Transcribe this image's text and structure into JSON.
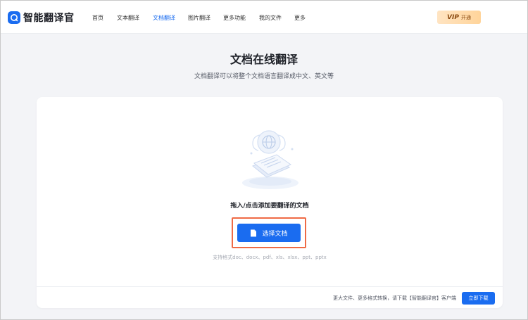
{
  "app": {
    "name": "智能翻译官"
  },
  "nav": {
    "items": [
      {
        "label": "首页",
        "active": false
      },
      {
        "label": "文本翻译",
        "active": false
      },
      {
        "label": "文档翻译",
        "active": true
      },
      {
        "label": "图片翻译",
        "active": false
      },
      {
        "label": "更多功能",
        "active": false
      },
      {
        "label": "我的文件",
        "active": false
      },
      {
        "label": "更多",
        "active": false
      }
    ]
  },
  "vip": {
    "badge": "VIP",
    "label": "开通"
  },
  "main": {
    "title": "文档在线翻译",
    "subtitle": "文档翻译可以将整个文档语言翻译成中文、英文等"
  },
  "upload": {
    "drop_text": "拖入/点击添加要翻译的文档",
    "button_label": "选择文档",
    "formats": "支持格式doc、docx、pdf、xls、xlsx、ppt、pptx"
  },
  "footer": {
    "promo_text": "更大文件、更多格式转换，请下载【智能翻译官】客户端",
    "download_label": "立即下载"
  },
  "colors": {
    "accent": "#1a6cf0",
    "highlight": "#ef6a45",
    "vip_bg": "#ffd49a"
  },
  "icons": {
    "logo": "logo-icon",
    "illustration": "document-globe-illustration",
    "button": "document-icon"
  }
}
